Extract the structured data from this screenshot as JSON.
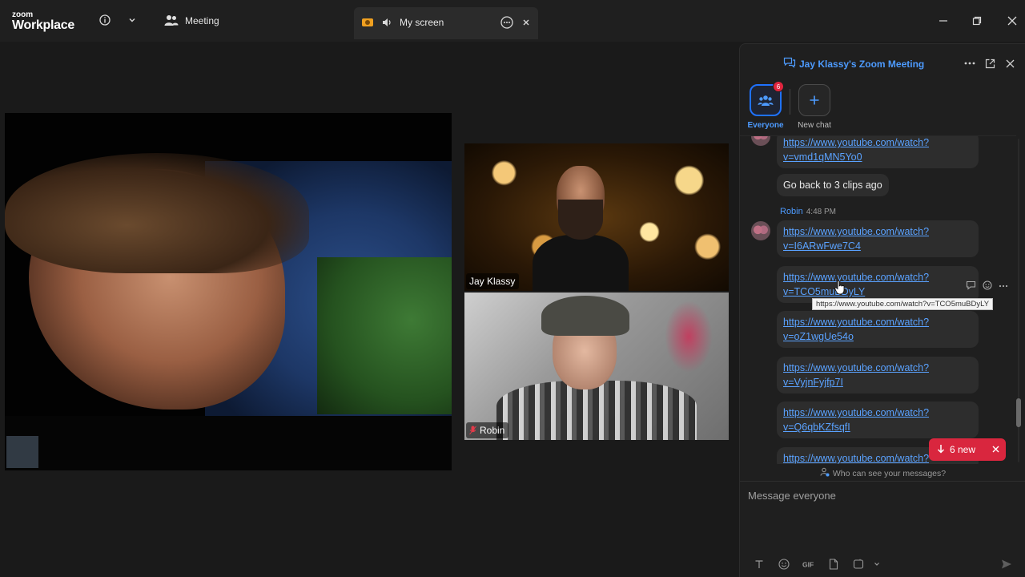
{
  "topbar": {
    "logo_line1": "zoom",
    "logo_line2": "Workplace",
    "meeting_label": "Meeting",
    "screen_tab_label": "My screen"
  },
  "video": {
    "tiles": [
      {
        "name": "Jay Klassy",
        "muted": false
      },
      {
        "name": "Robin",
        "muted": true
      }
    ]
  },
  "chat": {
    "title": "Jay Klassy's Zoom Meeting",
    "channels": [
      {
        "label": "Everyone",
        "badge": "6",
        "active": true,
        "icon": "people-icon"
      },
      {
        "label": "New chat",
        "badge": "",
        "active": false,
        "icon": "plus-icon"
      }
    ],
    "messages": {
      "m0_link": "https://www.youtube.com/watch?v=vmd1qMN5Yo0",
      "m1_text": "Go back to 3 clips ago",
      "sender_name": "Robin",
      "sender_time": "4:48 PM",
      "m2_link": "https://www.youtube.com/watch?v=I6ARwFwe7C4",
      "m3_link": "https://www.youtube.com/watch?v=TCO5muBDyLY",
      "m4_link": "https://www.youtube.com/watch?v=oZ1wgUe54o",
      "m5_link": "https://www.youtube.com/watch?v=VyjnFyjfp7I",
      "m6_link": "https://www.youtube.com/watch?v=Q6qbKZfsqfI",
      "m7_link": "https://www.youtube.com/watch?",
      "m0_display_1": "https://www.youtube.com/watch?",
      "m0_display_2": "v=vmd1qMN5Yo0",
      "m2_display_1": "https://www.youtube.com/watch?",
      "m2_display_2": "v=I6ARwFwe7C4",
      "m3_display_1": "https://www.youtube.com/watch?",
      "m3_display_2": "v=TCO5muBDyLY",
      "m4_display_1": "https://www.youtube.com/watch?",
      "m4_display_2": "v=oZ1wgUe54o",
      "m5_display_1": "https://www.youtube.com/watch?",
      "m5_display_2": "v=VyjnFyjfp7I",
      "m6_display_1": "https://www.youtube.com/watch?",
      "m6_display_2": "v=Q6qbKZfsqfI",
      "m7_display_1": "https://www.youtube.com/watch?"
    },
    "tooltip": "https://www.youtube.com/watch?v=TCO5muBDyLY",
    "new_pill": "6 new",
    "who_can_see": "Who can see your messages?",
    "composer_placeholder": "Message everyone"
  },
  "colors": {
    "accent": "#1f72ff",
    "link": "#5aa2ff",
    "alert": "#d9263e",
    "background": "#1a1a1a"
  }
}
